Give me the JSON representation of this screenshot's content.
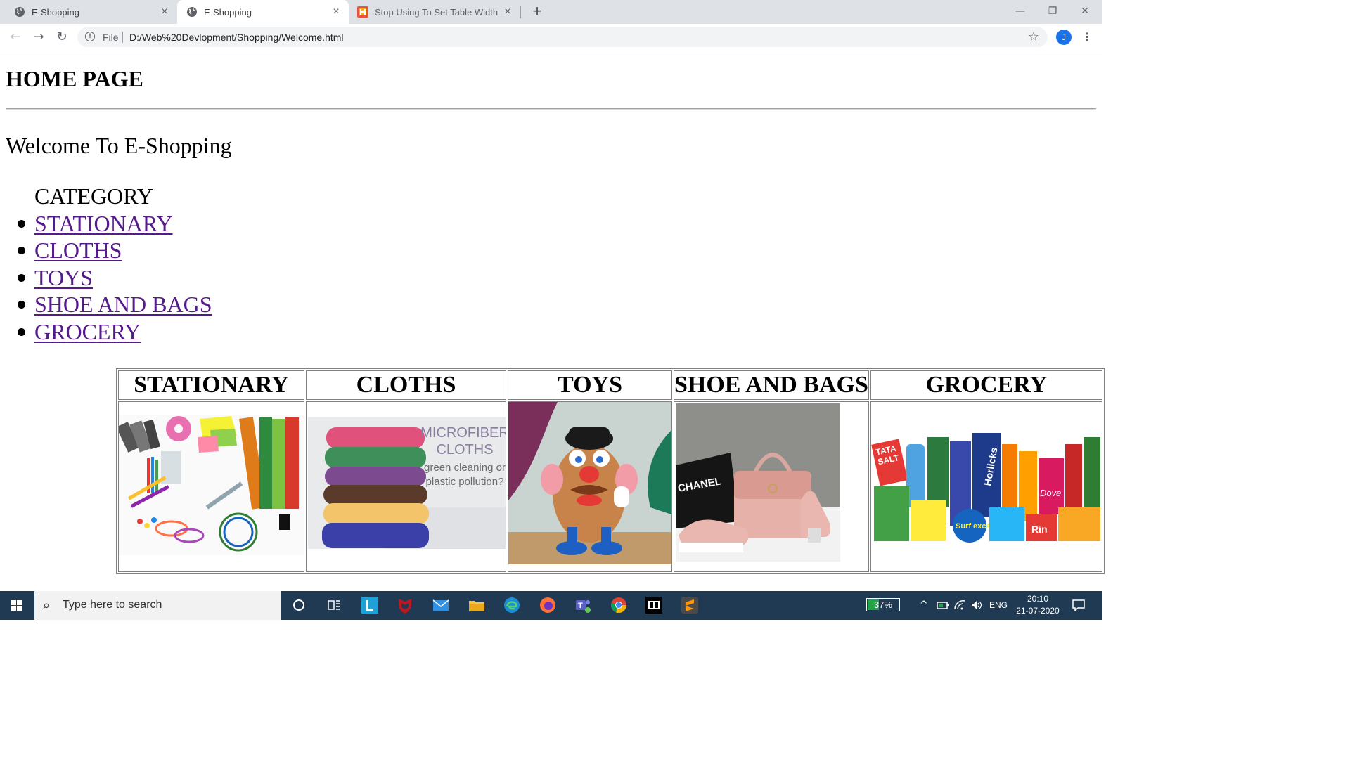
{
  "browser": {
    "tabs": [
      {
        "title": "E-Shopping",
        "close": "×"
      },
      {
        "title": "E-Shopping",
        "close": "×"
      },
      {
        "title": "Stop Using To Set Table Width In",
        "close": "×"
      }
    ],
    "new_tab": "+",
    "window_controls": {
      "minimize": "—",
      "restore": "❐",
      "close": "✕"
    },
    "nav": {
      "back": "←",
      "forward": "→",
      "reload": "↻"
    },
    "address": {
      "scheme_label": "File",
      "url": "D:/Web%20Devlopment/Shopping/Welcome.html"
    },
    "bookmark_icon": "☆",
    "profile_initial": "J",
    "menu_icon": "⋮"
  },
  "page": {
    "heading": "HOME PAGE",
    "welcome": "Welcome To E-Shopping",
    "category_title": "CATEGORY",
    "categories": [
      "STATIONARY",
      "CLOTHS",
      "TOYS",
      "SHOE AND BAGS",
      "GROCERY"
    ],
    "table_headers": [
      "STATIONARY",
      "CLOTHS",
      "TOYS",
      "SHOE AND BAGS",
      "GROCERY"
    ],
    "image_text": {
      "microfiber_1": "MICROFIBER",
      "microfiber_2": "CLOTHS",
      "microfiber_3": "green cleaning or",
      "microfiber_4": "plastic pollution?",
      "chanel": "CHANEL",
      "tata": "TATA",
      "salt": "SALT",
      "horlicks": "Horlicks",
      "surf": "Surf excel",
      "dove": "Dove",
      "rin": "Rin"
    },
    "link_color": "#551a8b"
  },
  "taskbar": {
    "search_placeholder": "Type here to search",
    "battery": "37%",
    "battery_level": 0.37,
    "lang": "ENG",
    "time": "20:10",
    "date": "21-07-2020",
    "color": "#1f3a52"
  }
}
